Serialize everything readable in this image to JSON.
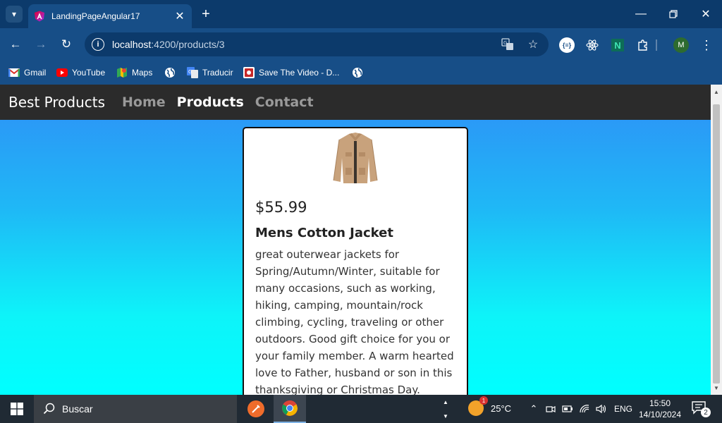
{
  "browser": {
    "tab": {
      "title": "LandingPageAngular17"
    },
    "url": {
      "host": "localhost",
      "path": ":4200/products/3"
    },
    "bookmarks": [
      {
        "label": "Gmail",
        "icon": "gmail-icon"
      },
      {
        "label": "YouTube",
        "icon": "youtube-icon"
      },
      {
        "label": "Maps",
        "icon": "maps-icon"
      },
      {
        "label": "",
        "icon": "globe-icon"
      },
      {
        "label": "Traducir",
        "icon": "translate-icon"
      },
      {
        "label": "Save The Video - D...",
        "icon": "save-video-icon"
      },
      {
        "label": "",
        "icon": "globe-icon"
      }
    ],
    "profile_initial": "M"
  },
  "site": {
    "brand": "Best Products",
    "nav": [
      {
        "label": "Home",
        "active": false
      },
      {
        "label": "Products",
        "active": true
      },
      {
        "label": "Contact",
        "active": false
      }
    ]
  },
  "product": {
    "price": "$55.99",
    "name": "Mens Cotton Jacket",
    "description": "great outerwear jackets for Spring/Autumn/Winter, suitable for many occasions, such as working, hiking, camping, mountain/rock climbing, cycling, traveling or other outdoors. Good gift choice for you or your family member. A warm hearted love to Father, husband or son in this thanksgiving or Christmas Day."
  },
  "taskbar": {
    "search_placeholder": "Buscar",
    "weather": {
      "temp": "25°C",
      "badge": "1"
    },
    "language": "ENG",
    "time": "15:50",
    "date": "14/10/2024",
    "notifications": "2"
  },
  "colors": {
    "tabstrip": "#0c3a6b",
    "toolbar": "#174e87",
    "site_nav": "#2b2b2b",
    "gradient_top": "#2f8ef7",
    "gradient_bottom": "#00ffff",
    "taskbar": "#202a34"
  }
}
